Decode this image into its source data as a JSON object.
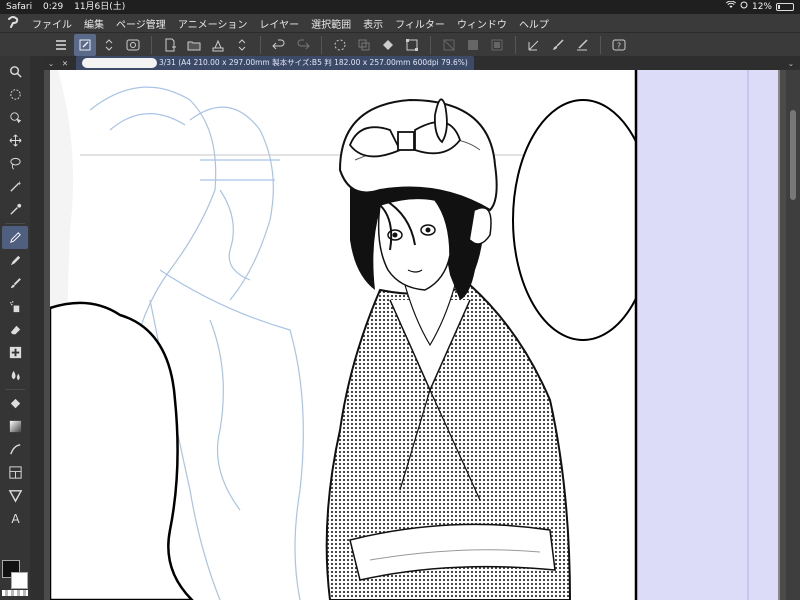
{
  "status_bar": {
    "app": "Safari",
    "time": "0:29",
    "date": "11月6日(土)",
    "battery": "12%"
  },
  "menu": {
    "items": [
      "ファイル",
      "編集",
      "ページ管理",
      "アニメーション",
      "レイヤー",
      "選択範囲",
      "表示",
      "フィルター",
      "ウィンドウ",
      "ヘルプ"
    ]
  },
  "canvas": {
    "tab_title": "3/31 (A4 210.00 x 297.00mm 製本サイズ:B5 判 182.00 x 257.00mm 600dpi 79.6%)"
  },
  "colors": {
    "ui_dark": "#3a3a3a",
    "accent": "#5a6a8a",
    "bleed": "#dcdcf8"
  }
}
